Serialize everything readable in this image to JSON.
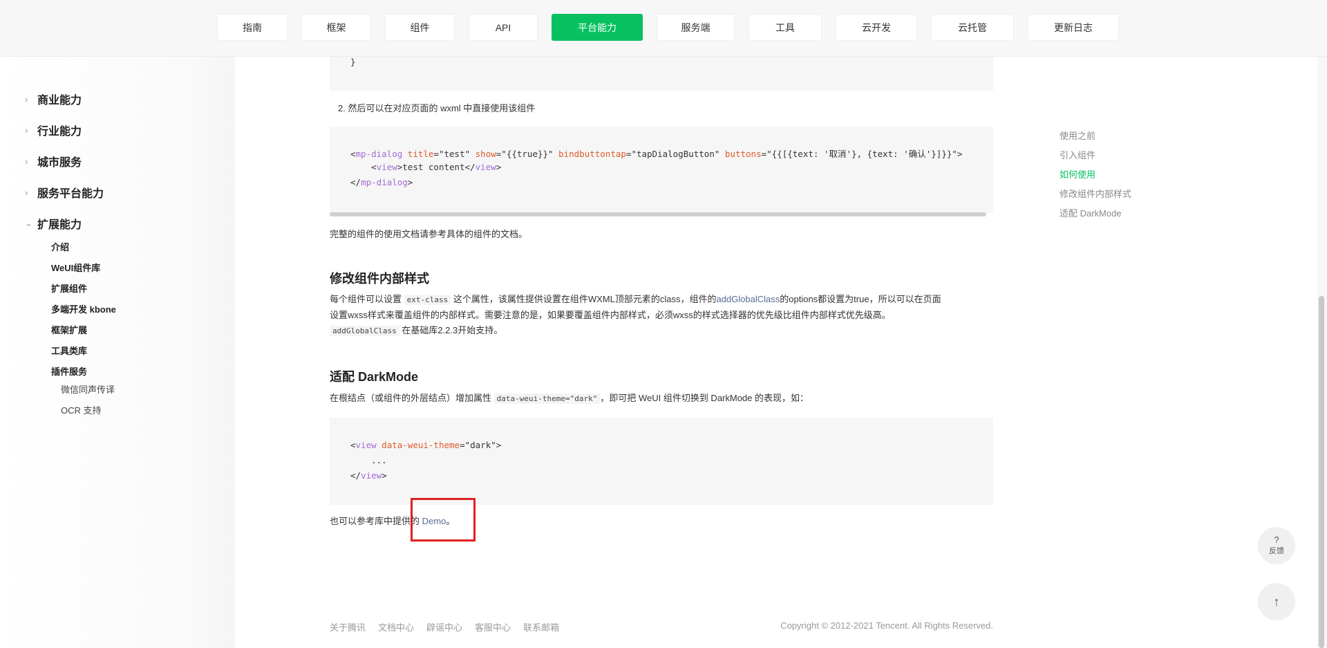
{
  "topnav": {
    "tabs": [
      {
        "label": "指南"
      },
      {
        "label": "框架"
      },
      {
        "label": "组件"
      },
      {
        "label": "API"
      },
      {
        "label": "平台能力"
      },
      {
        "label": "服务端"
      },
      {
        "label": "工具"
      },
      {
        "label": "云开发"
      },
      {
        "label": "云托管"
      },
      {
        "label": "更新日志"
      }
    ],
    "active_color": "#07c160"
  },
  "sidebar": {
    "items": [
      {
        "label": "商业能力",
        "chevron": "›"
      },
      {
        "label": "行业能力",
        "chevron": "›"
      },
      {
        "label": "城市服务",
        "chevron": "›"
      },
      {
        "label": "服务平台能力",
        "chevron": "›"
      },
      {
        "label": "扩展能力",
        "chevron": "⌄"
      }
    ],
    "subitems": [
      "介绍",
      "WeUI组件库",
      "扩展组件",
      "多端开发 kbone",
      "框架扩展",
      "工具类库",
      "插件服务"
    ],
    "subsubitems": [
      "微信同声传译",
      "OCR 支持"
    ]
  },
  "code1": {
    "brace": "}"
  },
  "step2": "2. 然后可以在对应页面的 wxml 中直接使用该组件",
  "code2": {
    "l1_open": "<",
    "l1_tag": "mp-dialog",
    "l1_a1": "title",
    "l1_v1": "=\"test\" ",
    "l1_a2": "show",
    "l1_v2": "=\"{{true}}\" ",
    "l1_a3": "bindbuttontap",
    "l1_v3": "=\"tapDialogButton\" ",
    "l1_a4": "buttons",
    "l1_v4": "=\"{{[{text: '取消'}, {text: '确认'}]}}\">",
    "l2_pre": "    <",
    "l2_tag": "view",
    "l2_post": ">test content</",
    "l2_tag2": "view",
    "l2_end": ">",
    "l3_pre": "</",
    "l3_tag": "mp-dialog",
    "l3_end": ">"
  },
  "para_full_doc": "完整的组件的使用文档请参考具体的组件的文档。",
  "section_style": {
    "heading": "修改组件内部样式",
    "p1_a": "每个组件可以设置 ",
    "p1_code": "ext-class",
    "p1_b": " 这个属性，该属性提供设置在组件WXML顶部元素的class，组件的",
    "p1_link": "addGlobalClass",
    "p1_c": "的options都设置为true，所以可以在页面",
    "p2": "设置wxss样式来覆盖组件的内部样式。需要注意的是，如果要覆盖组件内部样式，必须wxss的样式选择器的优先级比组件内部样式优先级高。",
    "p3_code": "addGlobalClass",
    "p3_b": " 在基础库2.2.3开始支持。"
  },
  "section_dark": {
    "heading": "适配 DarkMode",
    "p1_a": "在根结点（或组件的外层结点）增加属性 ",
    "p1_code": "data-weui-theme=\"dark\"",
    "p1_b": "，即可把 WeUI 组件切换到 DarkMode 的表现，如："
  },
  "code3": {
    "l1_open": "<",
    "l1_tag": "view",
    "l1_sp": " ",
    "l1_attr": "data-weui-theme",
    "l1_val": "=\"dark\">",
    "l2": "    ...",
    "l3_pre": "</",
    "l3_tag": "view",
    "l3_end": ">"
  },
  "demo_para": {
    "pre": "也可以参考库中提供的 ",
    "link": "Demo",
    "post": "。"
  },
  "toc": {
    "items": [
      "使用之前",
      "引入组件",
      "如何使用",
      "修改组件内部样式",
      "适配 DarkMode"
    ],
    "active_index": 2
  },
  "floating": {
    "feedback_icon": "?",
    "feedback_label": "反馈",
    "top_icon": "↑"
  },
  "footer": {
    "links": [
      "关于腾讯",
      "文档中心",
      "辟谣中心",
      "客服中心",
      "联系邮箱"
    ],
    "copyright": "Copyright © 2012-2021 Tencent. All Rights Reserved."
  }
}
